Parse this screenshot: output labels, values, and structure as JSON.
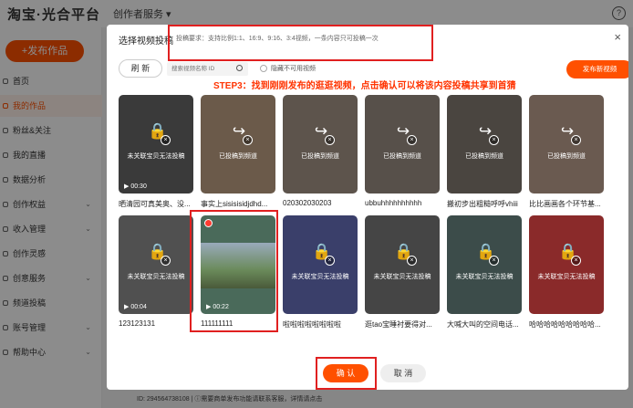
{
  "app": {
    "logo": "淘宝·光合平台",
    "nav": "创作者服务 ▾"
  },
  "sidebar": {
    "publish": "+发布作品",
    "items": [
      {
        "label": "首页",
        "chev": ""
      },
      {
        "label": "我的作品",
        "chev": ""
      },
      {
        "label": "粉丝&关注",
        "chev": ""
      },
      {
        "label": "我的直播",
        "chev": ""
      },
      {
        "label": "数据分析",
        "chev": ""
      },
      {
        "label": "创作权益",
        "chev": "⌄"
      },
      {
        "label": "收入管理",
        "chev": "⌄"
      },
      {
        "label": "创作灵感",
        "chev": ""
      },
      {
        "label": "创意服务",
        "chev": "⌄"
      },
      {
        "label": "频道投稿",
        "chev": ""
      },
      {
        "label": "账号管理",
        "chev": "⌄"
      },
      {
        "label": "帮助中心",
        "chev": "⌄"
      }
    ]
  },
  "bottom_notice": "ID: 294564738108 | ⓘ需要商单发布功能请联系客服，详情请点击",
  "modal": {
    "title": "选择视频投稿",
    "requirements": "投稿要求：支持比例1:1、16:9、9:16、3:4视频，一条内容只可投稿一次",
    "refresh": "刷 新",
    "search_placeholder": "搜索视频名称 ID",
    "hide_label": "隐藏不可用视频",
    "step": "STEP3：找到刚刚发布的逛逛视频，点击确认可以将该内容投稿共享到首猜",
    "publish_video": "发布新视频",
    "confirm": "确 认",
    "cancel": "取 消",
    "close": "×"
  },
  "videos": [
    {
      "caption": "晒清园可真美奥、没...",
      "status": "未关联宝贝无法投稿",
      "duration": "▶ 00:30",
      "icon": "lock-icon",
      "color": "#3a3a3a"
    },
    {
      "caption": "事实上sisisisidjdhd...",
      "status": "已投稿到频道",
      "duration": "",
      "icon": "share-icon",
      "color": "#6b5a4a"
    },
    {
      "caption": "020302030203",
      "status": "已投稿到频道",
      "duration": "",
      "icon": "share-icon",
      "color": "#5d544c"
    },
    {
      "caption": "ubbuhhhhhhhhhh",
      "status": "已投稿到频道",
      "duration": "",
      "icon": "share-icon",
      "color": "#57504a"
    },
    {
      "caption": "搬初步出粗糙呼呼vhiii",
      "status": "已投稿到频道",
      "duration": "",
      "icon": "share-icon",
      "color": "#4a4540"
    },
    {
      "caption": "比比画画各个环节基...",
      "status": "已投稿到频道",
      "duration": "",
      "icon": "share-icon",
      "color": "#6a5a50"
    },
    {
      "caption": "123123131",
      "status": "未关联宝贝无法投稿",
      "duration": "▶ 00:04",
      "icon": "lock-icon",
      "color": "#505050"
    },
    {
      "caption": "111111111",
      "status": "",
      "duration": "▶ 00:22",
      "icon": "",
      "color": "#4a6a5a"
    },
    {
      "caption": "啦啦啦啦啦啦啦啦",
      "status": "未关联宝贝无法投稿",
      "duration": "",
      "icon": "lock-icon",
      "color": "#3a3f6a"
    },
    {
      "caption": "逛tao宝睡衬要得对...",
      "status": "未关联宝贝无法投稿",
      "duration": "",
      "icon": "lock-icon",
      "color": "#454545"
    },
    {
      "caption": "大喊大叫的空间电话...",
      "status": "未关联宝贝无法投稿",
      "duration": "",
      "icon": "lock-icon",
      "color": "#3c4c4a"
    },
    {
      "caption": "哈哈哈哈哈哈哈哈哈...",
      "status": "未关联宝贝无法投稿",
      "duration": "",
      "icon": "lock-icon",
      "color": "#8a2a2a"
    }
  ]
}
